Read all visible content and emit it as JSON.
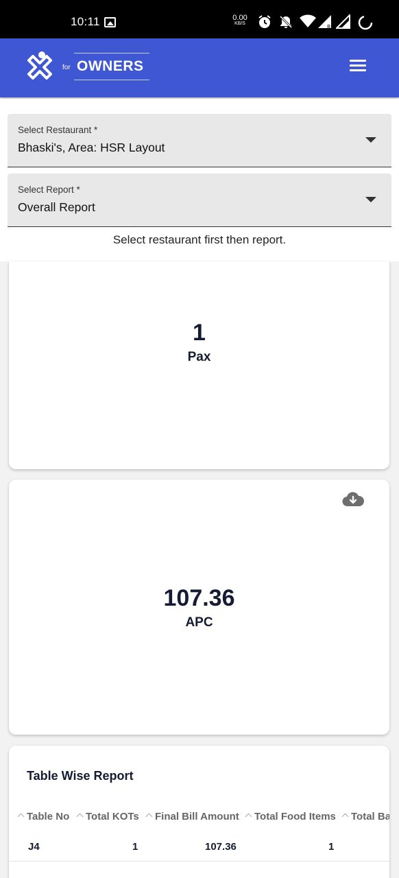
{
  "status_bar": {
    "time": "10:11",
    "net_speed": "0.00",
    "net_unit": "KB/S"
  },
  "app_bar": {
    "logo_prefix": "for",
    "logo_text": "OWNERS"
  },
  "filters": {
    "restaurant": {
      "label": "Select Restaurant *",
      "value": "Bhaski's, Area: HSR Layout"
    },
    "report": {
      "label": "Select Report *",
      "value": "Overall Report"
    },
    "hint": "Select restaurant first then report."
  },
  "metrics": {
    "pax": {
      "value": "1",
      "label": "Pax"
    },
    "apc": {
      "value": "107.36",
      "label": "APC"
    }
  },
  "table_report": {
    "title": "Table Wise Report",
    "columns": [
      "Table No",
      "Total KOTs",
      "Final Bill Amount",
      "Total Food Items",
      "Total Ba"
    ],
    "rows": [
      {
        "table_no": "J4",
        "total_kots": "1",
        "final_bill_amount": "107.36",
        "total_food_items": "1"
      }
    ]
  },
  "colors": {
    "app_bar": "#3f57d3",
    "status_bar": "#000000",
    "metric_text": "#141b33"
  }
}
